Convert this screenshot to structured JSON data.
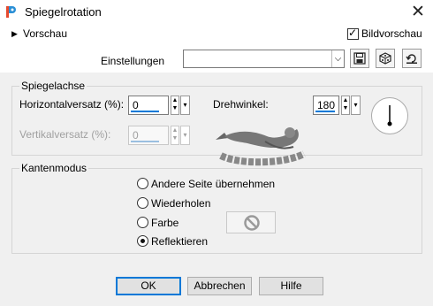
{
  "window": {
    "title": "Spiegelrotation",
    "close_glyph": "✕"
  },
  "preview": {
    "label": "Vorschau",
    "arrow": "▶",
    "bildvorschau_label": "Bildvorschau",
    "bildvorschau_checked": true
  },
  "settings": {
    "label": "Einstellungen",
    "value": "",
    "arrow": "⌵"
  },
  "mirror_axis": {
    "title": "Spiegelachse",
    "horizontal_label": "Horizontalversatz (%):",
    "horizontal_value": "0",
    "vertical_label": "Vertikalversatz (%):",
    "vertical_value": "0",
    "rotation_label": "Drehwinkel:",
    "rotation_value": "180"
  },
  "spinner": {
    "up": "▲",
    "down": "▼",
    "dropdown": "▾"
  },
  "edge_mode": {
    "title": "Kantenmodus",
    "options": [
      "Andere Seite übernehmen",
      "Wiederholen",
      "Farbe",
      "Reflektieren"
    ],
    "selected": "Reflektieren"
  },
  "buttons": {
    "ok": "OK",
    "cancel": "Abbrechen",
    "help": "Hilfe"
  },
  "colors": {
    "accent": "#0078d7",
    "dialog_bg": "#f0f0f0"
  }
}
